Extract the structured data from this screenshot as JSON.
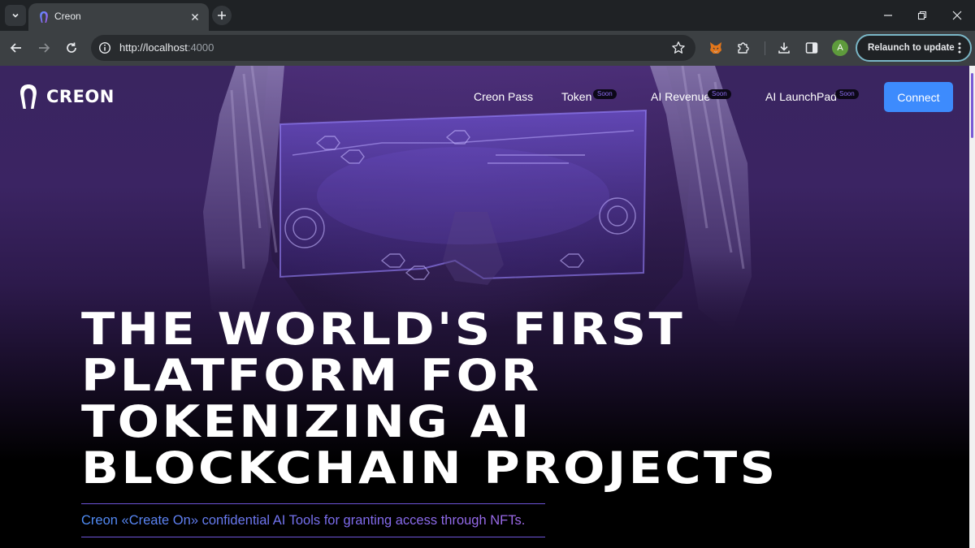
{
  "browser": {
    "tab_title": "Creon",
    "url_host": "http://localhost",
    "url_port": ":4000",
    "relaunch_label": "Relaunch to update",
    "profile_initial": "A"
  },
  "site": {
    "logo_text": "CREON",
    "nav": [
      {
        "label": "Creon Pass",
        "badge": ""
      },
      {
        "label": "Token",
        "badge": "Soon"
      },
      {
        "label": "AI Revenue",
        "badge": "Soon"
      },
      {
        "label": "AI LaunchPad",
        "badge": "Soon"
      }
    ],
    "connect_label": "Connect",
    "headline_lines": [
      "THE WORLD'S FIRST",
      "PLATFORM FOR",
      "TOKENIZING AI",
      "BLOCKCHAIN PROJECTS"
    ],
    "subheadline": "Creon «Create On» confidential AI Tools for granting access through NFTs."
  },
  "colors": {
    "accent_blue": "#3d8bfd",
    "accent_purple": "#7f6cf0",
    "badge_text": "#8b6cf0"
  }
}
